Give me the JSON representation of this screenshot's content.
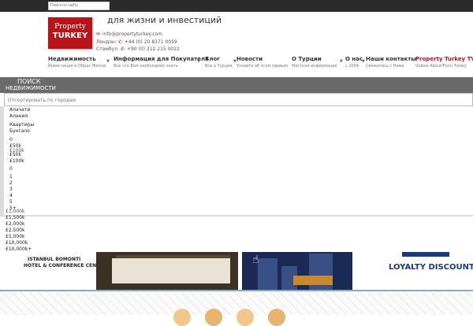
{
  "header": {
    "search_placeholder": "Поиск по сайту",
    "logo": {
      "line1": "Property",
      "line2": "TURKEY"
    },
    "tagline": "для жизни и инвестиций",
    "contacts": [
      {
        "icon": "envelope-icon",
        "text": "info@propertyturkey.com"
      },
      {
        "icon": "phone-icon",
        "label": "Лондон:",
        "text": "+44 (0) 20 8371 0059"
      },
      {
        "icon": "phone-icon",
        "label": "Стамбул:",
        "text": "+90 (0) 212 215 0022"
      }
    ]
  },
  "nav": {
    "items": [
      {
        "title": "Недвижимость",
        "sub": "Инвестиция и Образ Жизни",
        "caret": true
      },
      {
        "title": "Информация для Покупателя",
        "sub": "Все что Вам необходимо знать",
        "caret": true
      },
      {
        "title": "Блог",
        "sub": "Все о Турции",
        "caret": true
      },
      {
        "title": "Новости",
        "sub": "Узнайте об этом первым",
        "caret": false
      },
      {
        "title": "О Турции",
        "sub": "Местная информация",
        "caret": true
      },
      {
        "title": "О нас",
        "sub": "с 2004",
        "caret": true
      },
      {
        "title": "Наши контакты",
        "sub": "Свяжитесь с Нами",
        "caret": false
      },
      {
        "title": "Property Turkey TV",
        "sub": "Videos About/From Turkey",
        "caret": false
      }
    ]
  },
  "search_panel": {
    "title_line1": "ПОИСК",
    "title_line2": "НЕДВИЖИМОСТИ",
    "sort_placeholder": "Отсортировать по городам"
  },
  "dropdown": {
    "cities": [
      "Алачати",
      "Алания"
    ],
    "types": [
      "Квартиры",
      "Бунгало"
    ],
    "min_prices": [
      "0",
      "£50k",
      "£100k"
    ],
    "max_prices": [
      "£50k",
      "£100k"
    ],
    "bedrooms": [
      "0",
      "1",
      "2",
      "3",
      "4",
      "5",
      "5+"
    ],
    "high_prices": [
      "£1,000k",
      "£1,500k",
      "£2,000k",
      "£2,500k",
      "£5,000k",
      "£10,000k",
      "£10,000k+"
    ]
  },
  "banners": {
    "hotel_line1": "ISTANBUL BOMONTI",
    "hotel_line2": "HOTEL & CONFERENCE CENTER",
    "loyalty": "LOYALTY DISCOUNT"
  },
  "colors": {
    "brand_red": "#b8141b",
    "topbar": "#2b2b2b",
    "search_bar": "#6a6a6a"
  }
}
